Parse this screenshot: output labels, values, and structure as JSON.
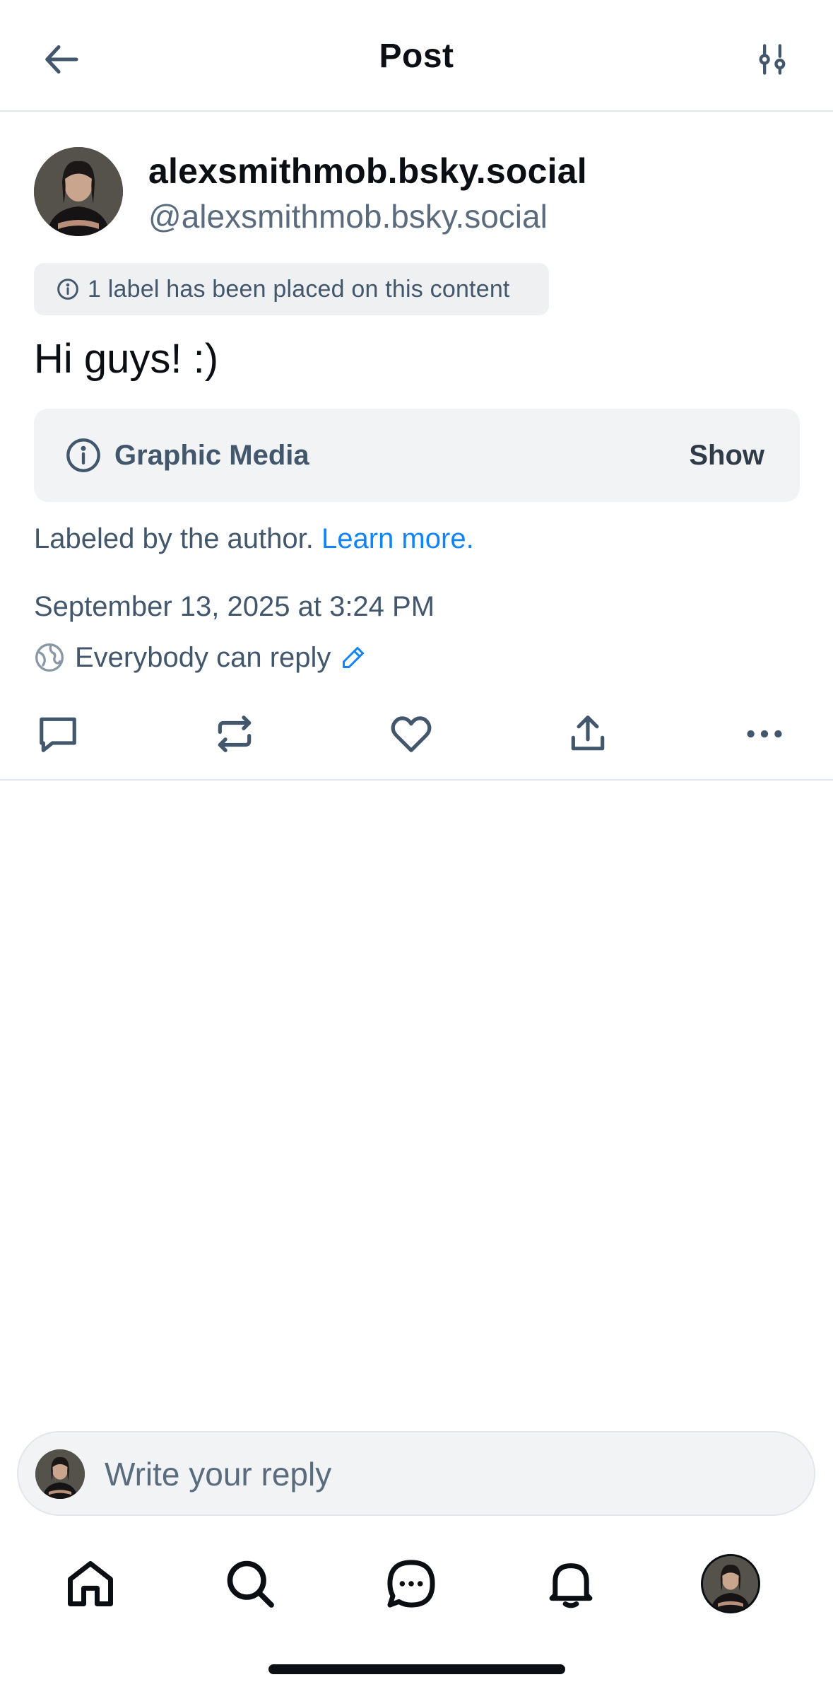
{
  "header": {
    "title": "Post"
  },
  "author": {
    "display_name": "alexsmithmob.bsky.social",
    "handle": "@alexsmithmob.bsky.social"
  },
  "label_pill": {
    "text": "1 label has been placed on this content"
  },
  "post": {
    "text": "Hi guys! :)"
  },
  "content_warning": {
    "title": "Graphic Media",
    "action_label": "Show"
  },
  "labeled_by": {
    "text": "Labeled by the author.",
    "link_text": "Learn more."
  },
  "timestamp": "September 13, 2025 at 3:24 PM",
  "reply_settings": {
    "text": "Everybody can reply"
  },
  "actions": [
    "reply-icon",
    "repost-icon",
    "like-icon",
    "share-icon",
    "more-icon"
  ],
  "reply_box": {
    "placeholder": "Write your reply"
  },
  "tabs": [
    "home",
    "search",
    "chat",
    "notifications",
    "profile"
  ],
  "colors": {
    "accent": "#1083fe",
    "text_secondary": "#42576c",
    "muted": "#5a6b7e",
    "surface": "#f1f3f5"
  }
}
